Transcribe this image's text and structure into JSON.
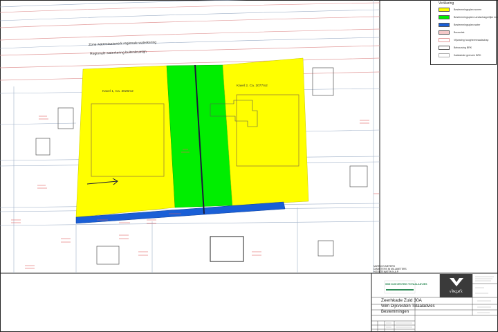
{
  "legend": {
    "title": "Verklaring",
    "items": [
      {
        "label": "Bestemmingsplan wonen",
        "color": "#ffff00",
        "kind": "fill"
      },
      {
        "label": "Bestemmingsplan Landschappelijke inpassing",
        "color": "#00ee00",
        "kind": "fill"
      },
      {
        "label": "Bestemmingsplan water",
        "color": "#1a5fd6",
        "kind": "fill"
      },
      {
        "label": "Bouwvlak",
        "color": "#f4c8c8",
        "kind": "fill"
      },
      {
        "label": "Vrijwaring hoogheemraadschap",
        "color": "#e29a9a",
        "kind": "line"
      },
      {
        "label": "Bebouwing BRK",
        "color": "#555555",
        "kind": "line"
      },
      {
        "label": "Kadastrale grenzen BRK",
        "color": "#aaaaaa",
        "kind": "line"
      }
    ]
  },
  "map": {
    "waterway_zone_label": "Zone waterstaatswerk regionale waterkering",
    "waterway_label": "Regionale waterkering buitenkruinlijn",
    "lot1_label": "Kavel 1, Ca. 3026m2",
    "lot2_label": "Kavel 2, Ca. 2077m2"
  },
  "title_block": {
    "company_name": "WIM DIJKVESTEIN TOTAALADVIES",
    "brand": "vertex",
    "note_lines": [
      "MATEN IN METERS",
      "DIAMETERS IN MILLIMETERS",
      "HOOGTEMATEN N.A.P."
    ],
    "project_address": "Zeerhkade Zuid 30A",
    "client": "Wim Dijkvestein Totaaladvies",
    "drawing_subject": "Bestemmingen"
  },
  "colors": {
    "wonen": "#ffff00",
    "groen": "#00ee00",
    "water": "#1a5fd6",
    "border_red": "#e08080",
    "brand_green": "#2e8b57"
  }
}
